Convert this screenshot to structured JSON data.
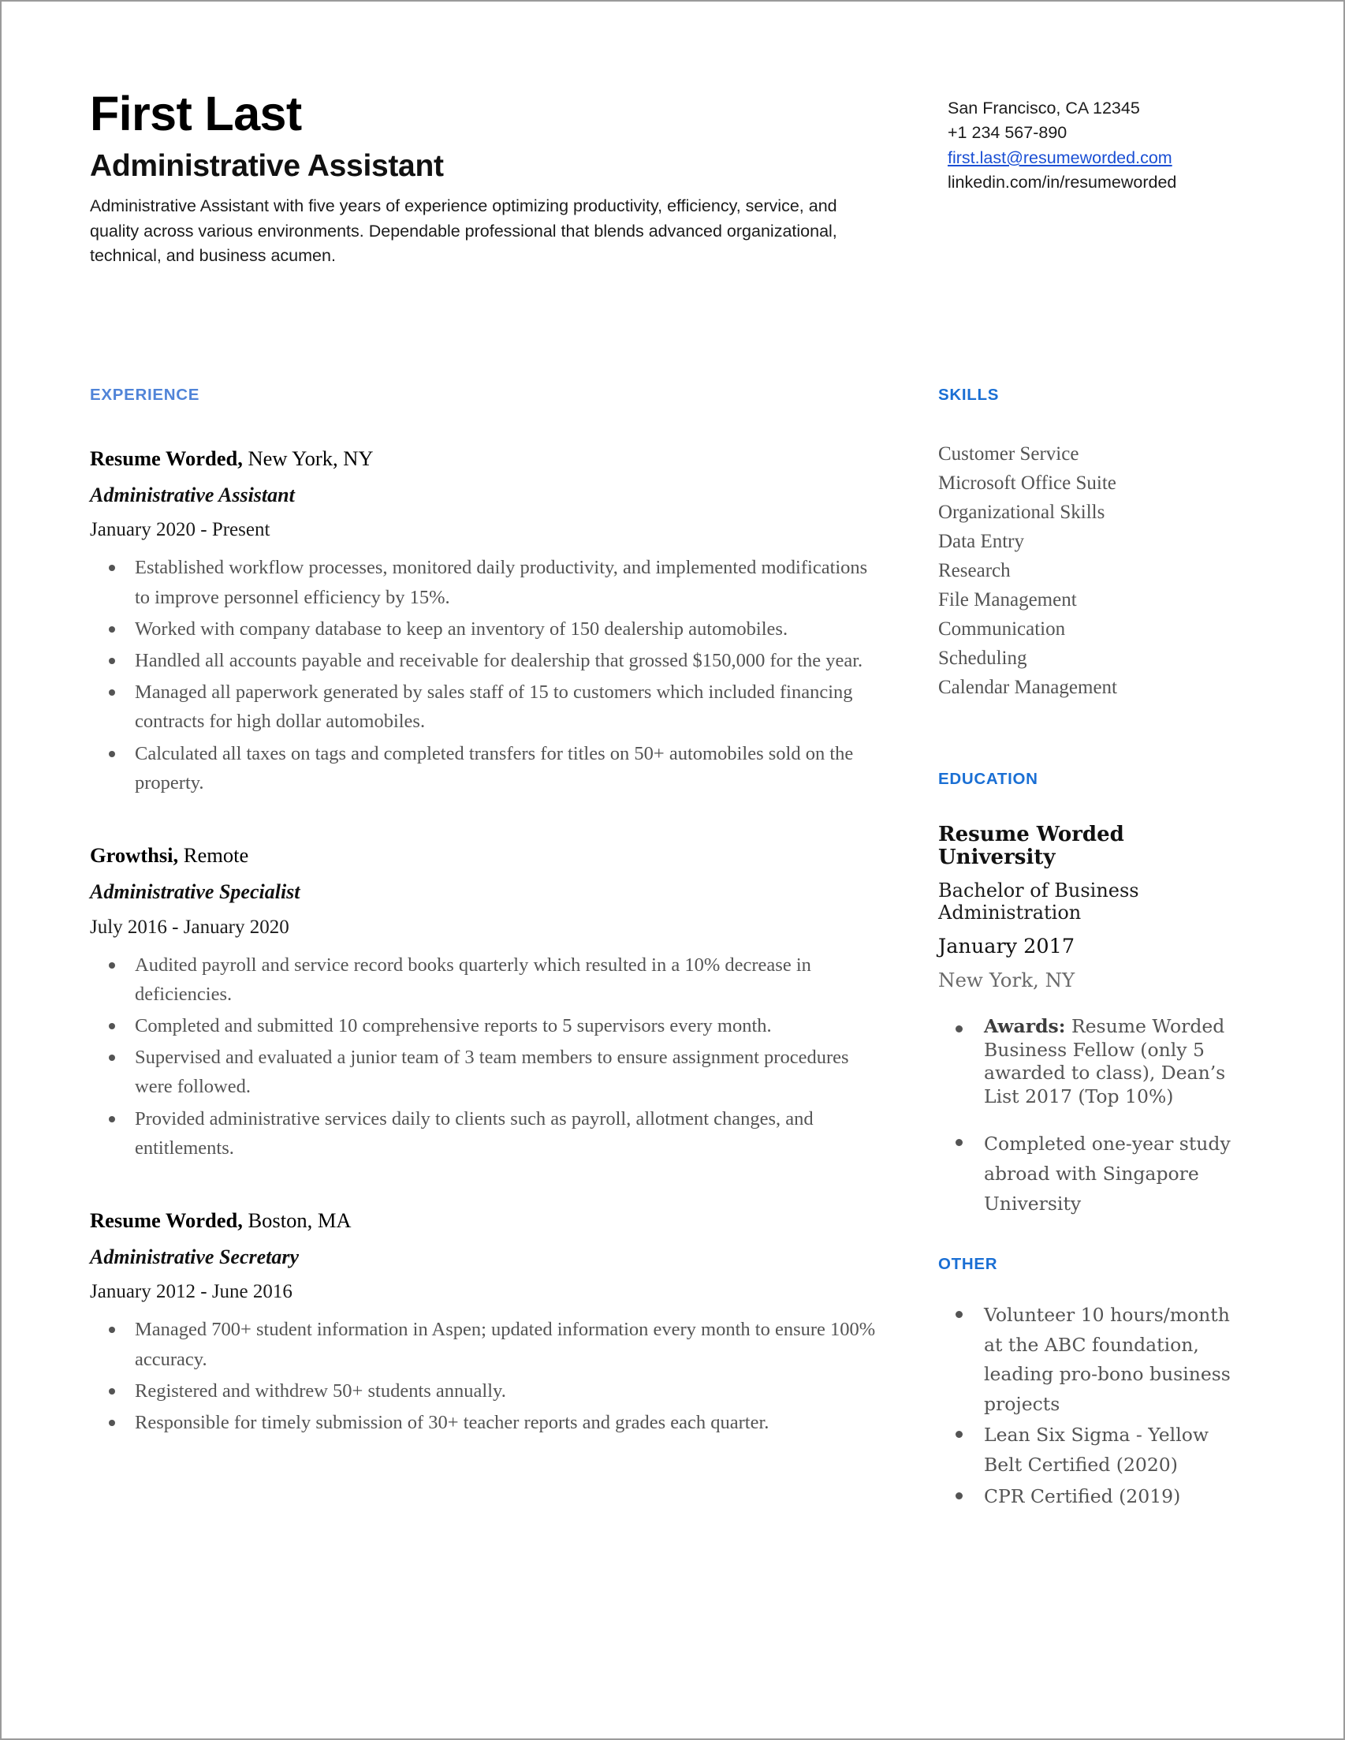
{
  "header": {
    "name": "First Last",
    "job_title": "Administrative Assistant",
    "summary": "Administrative Assistant with five years of experience optimizing productivity, efficiency, service, and quality across various environments. Dependable professional that blends advanced organizational, technical, and business acumen.",
    "contact": {
      "location": "San Francisco, CA 12345",
      "phone": "+1 234 567-890",
      "email": "first.last@resumeworded.com",
      "linkedin": "linkedin.com/in/resumeworded"
    }
  },
  "colors": {
    "section_header_blue": "#1a6fd4",
    "experience_header_blue": "#5084d8",
    "link_blue": "#1a4fd4",
    "body_text": "#545454",
    "heading_text": "#111111",
    "page_border": "#9a9a9a"
  },
  "experience": {
    "heading": "EXPERIENCE",
    "jobs": [
      {
        "company": "Resume Worded,",
        "location": "New York, NY",
        "role": "Administrative Assistant",
        "dates": "January 2020 - Present",
        "bullets": [
          "Established workflow processes, monitored daily productivity, and implemented modifications to improve personnel efficiency by 15%.",
          "Worked with company database to keep an inventory of 150 dealership automobiles.",
          "Handled all accounts payable and receivable for dealership that grossed $150,000 for the year.",
          "Managed all paperwork generated by sales staff of 15 to customers which included financing contracts for high dollar automobiles.",
          "Calculated all taxes on tags and completed transfers for titles on 50+ automobiles sold on the property."
        ]
      },
      {
        "company": "Growthsi,",
        "location": "Remote",
        "role": "Administrative Specialist",
        "dates": "July 2016 - January 2020",
        "bullets": [
          "Audited payroll and service record books quarterly which resulted in a 10% decrease in deficiencies.",
          "Completed and submitted 10 comprehensive reports to 5 supervisors every month.",
          "Supervised and evaluated a junior team of 3 team members to ensure assignment procedures were followed.",
          "Provided administrative services daily to clients such as payroll, allotment changes, and entitlements."
        ]
      },
      {
        "company": "Resume Worded,",
        "location": "Boston, MA",
        "role": "Administrative Secretary",
        "dates": "January 2012 - June 2016",
        "bullets": [
          "Managed 700+ student information in Aspen; updated information every month to ensure 100% accuracy.",
          "Registered and withdrew 50+ students annually.",
          "Responsible for timely submission of 30+ teacher reports and grades each quarter."
        ]
      }
    ]
  },
  "skills": {
    "heading": "SKILLS",
    "items": [
      "Customer Service",
      "Microsoft Office Suite",
      "Organizational Skills",
      "Data Entry",
      "Research",
      "File Management",
      "Communication",
      "Scheduling",
      "Calendar Management"
    ]
  },
  "education": {
    "heading": "EDUCATION",
    "school": "Resume Worded University",
    "degree": "Bachelor of Business Administration",
    "date": "January 2017",
    "location": "New York, NY",
    "bullets": [
      {
        "label": "Awards:",
        "text": " Resume Worded Business Fellow (only 5 awarded to class), Dean’s List 2017 (Top 10%)",
        "spacing": "tight"
      },
      {
        "label": "",
        "text": "Completed one-year study abroad with Singapore University",
        "spacing": "loose"
      }
    ]
  },
  "other": {
    "heading": "OTHER",
    "items": [
      "Volunteer 10 hours/month at the ABC foundation, leading pro-bono business projects",
      "Lean Six Sigma - Yellow Belt Certified (2020)",
      "CPR Certified (2019)"
    ]
  }
}
